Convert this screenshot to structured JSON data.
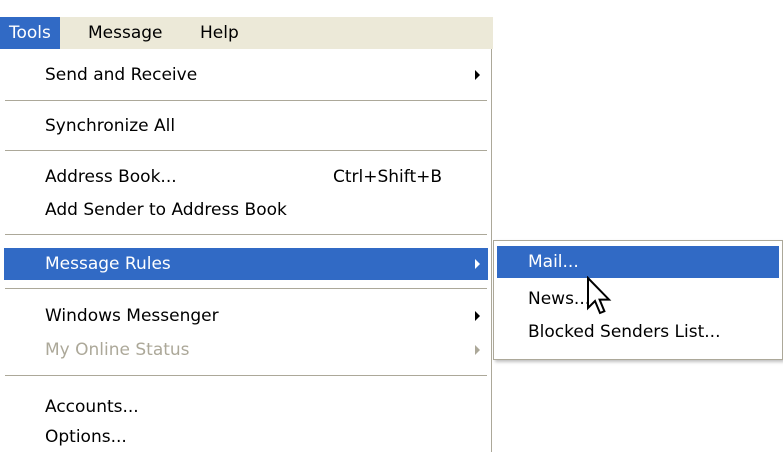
{
  "menubar": {
    "items": [
      {
        "label": "Tools"
      },
      {
        "label": "Message"
      },
      {
        "label": "Help"
      }
    ]
  },
  "menu": {
    "items": [
      {
        "label": "Send and Receive"
      },
      {
        "label": "Synchronize All"
      },
      {
        "label": "Address Book...",
        "shortcut": "Ctrl+Shift+B"
      },
      {
        "label": "Add Sender to Address Book"
      },
      {
        "label": "Message Rules"
      },
      {
        "label": "Windows Messenger"
      },
      {
        "label": "My Online Status"
      },
      {
        "label": "Accounts..."
      },
      {
        "label": "Options..."
      }
    ]
  },
  "submenu": {
    "items": [
      {
        "label": "Mail..."
      },
      {
        "label": "News..."
      },
      {
        "label": "Blocked Senders List..."
      }
    ]
  },
  "icons": {
    "submenu_arrow": "triangle-right-icon",
    "cursor": "mouse-pointer-icon"
  },
  "colors": {
    "highlight": "#316ac5",
    "menubar_bg": "#ece9d8",
    "disabled_text": "#aca899"
  }
}
